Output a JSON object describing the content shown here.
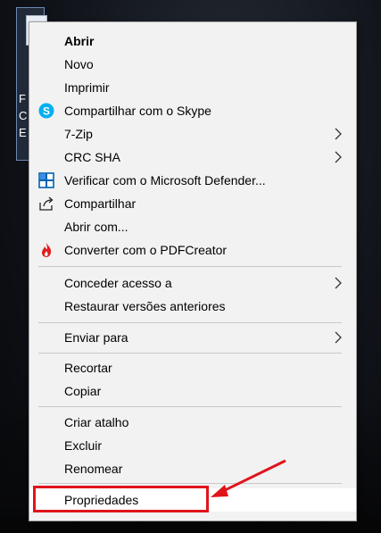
{
  "desktop_icon": {
    "caption": "F\nC\nE",
    "icon": "document-icon"
  },
  "menu": {
    "items": [
      {
        "label": "Abrir",
        "bold": true
      },
      {
        "label": "Novo"
      },
      {
        "label": "Imprimir"
      },
      {
        "label": "Compartilhar com o Skype",
        "icon": "skype-icon"
      },
      {
        "label": "7-Zip",
        "submenu": true
      },
      {
        "label": "CRC SHA",
        "submenu": true
      },
      {
        "label": "Verificar com o Microsoft Defender...",
        "icon": "defender-icon"
      },
      {
        "label": "Compartilhar",
        "icon": "share-icon"
      },
      {
        "label": "Abrir com..."
      },
      {
        "label": "Converter com o PDFCreator",
        "icon": "pdfcreator-icon"
      },
      {
        "label": "Conceder acesso a",
        "submenu": true
      },
      {
        "label": "Restaurar versões anteriores"
      },
      {
        "label": "Enviar para",
        "submenu": true
      },
      {
        "label": "Recortar"
      },
      {
        "label": "Copiar"
      },
      {
        "label": "Criar atalho"
      },
      {
        "label": "Excluir"
      },
      {
        "label": "Renomear"
      },
      {
        "label": "Propriedades",
        "highlighted": true
      }
    ]
  },
  "colors": {
    "menu_background": "#f2f2f2",
    "annotation_red": "#e0141b",
    "skype_blue": "#00aff0",
    "defender_blue": "#0063b1"
  }
}
